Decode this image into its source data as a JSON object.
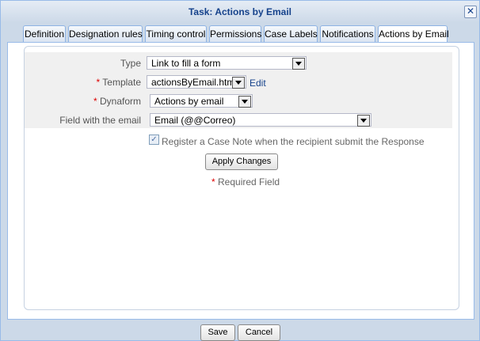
{
  "dialog": {
    "title": "Task: Actions by Email",
    "close_glyph": "✕"
  },
  "tabs": [
    {
      "label": "Definition"
    },
    {
      "label": "Designation rules"
    },
    {
      "label": "Timing control"
    },
    {
      "label": "Permissions"
    },
    {
      "label": "Case Labels"
    },
    {
      "label": "Notifications"
    },
    {
      "label": "Actions by Email",
      "active": true
    }
  ],
  "form": {
    "type": {
      "label": "Type",
      "value": "Link to fill a form"
    },
    "template": {
      "required_mark": "*",
      "label": "Template",
      "value": "actionsByEmail.html",
      "edit_link": "Edit"
    },
    "dynaform": {
      "required_mark": "*",
      "label": "Dynaform",
      "value": "Actions by email"
    },
    "email_field": {
      "label": "Field with the email",
      "value": "Email (@@Correo)"
    },
    "register_note": {
      "checked": true,
      "check_glyph": "✓",
      "label": "Register a Case Note when the recipient submit the Response"
    },
    "apply_button": "Apply Changes",
    "required_note": {
      "mark": "*",
      "text": "Required Field"
    }
  },
  "footer": {
    "save_label": "Save",
    "cancel_label": "Cancel"
  },
  "colors": {
    "title_text": "#15428b",
    "required": "#dd0000",
    "link": "#15428b"
  }
}
